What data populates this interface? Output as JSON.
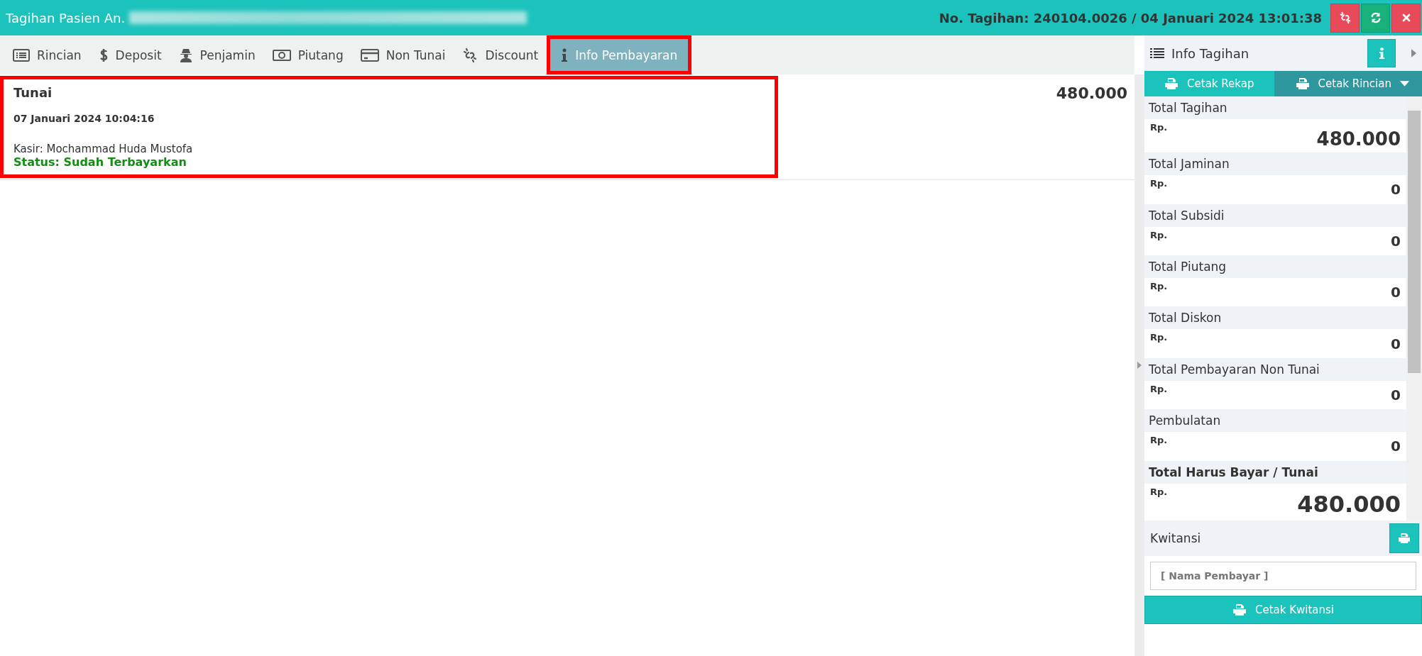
{
  "header": {
    "title": "Tagihan Pasien An.",
    "invoice": "No. Tagihan: 240104.0026 / 04 Januari 2024 13:01:38",
    "actions": [
      {
        "kind": "unlink"
      },
      {
        "kind": "refresh"
      },
      {
        "kind": "close"
      }
    ]
  },
  "tabs": [
    {
      "label": "Rincian",
      "kind": "list",
      "selected": false,
      "highlighted": false
    },
    {
      "label": "Deposit",
      "kind": "dollar",
      "selected": false,
      "highlighted": false
    },
    {
      "label": "Penjamin",
      "kind": "agent",
      "selected": false,
      "highlighted": false
    },
    {
      "label": "Piutang",
      "kind": "money",
      "selected": false,
      "highlighted": false
    },
    {
      "label": "Non Tunai",
      "kind": "card",
      "selected": false,
      "highlighted": false
    },
    {
      "label": "Discount",
      "kind": "unlink",
      "selected": false,
      "highlighted": false
    },
    {
      "label": "Info Pembayaran",
      "kind": "info",
      "selected": true,
      "highlighted": true
    }
  ],
  "payments": [
    {
      "method": "Tunai",
      "date": "07 Januari 2024 10:04:16",
      "cashier": "Kasir: Mochammad Huda Mustofa",
      "status": "Status: Sudah Terbayarkan",
      "amount": "480.000",
      "highlighted": true
    }
  ],
  "side_panel": {
    "title": "Info Tagihan",
    "print_buttons": [
      {
        "label": "Cetak Rekap",
        "dropdown": false
      },
      {
        "label": "Cetak Rincian",
        "dropdown": true
      }
    ],
    "totals": [
      {
        "label": "Total Tagihan",
        "currency": "Rp.",
        "value": "480.000",
        "kind": "headline"
      },
      {
        "label": "Total Jaminan",
        "currency": "Rp.",
        "value": "0",
        "kind": "line"
      },
      {
        "label": "Total Subsidi",
        "currency": "Rp.",
        "value": "0",
        "kind": "line"
      },
      {
        "label": "Total Piutang",
        "currency": "Rp.",
        "value": "0",
        "kind": "line"
      },
      {
        "label": "Total Diskon",
        "currency": "Rp.",
        "value": "0",
        "kind": "line"
      },
      {
        "label": "Total Pembayaran Non Tunai",
        "currency": "Rp.",
        "value": "0",
        "kind": "line"
      },
      {
        "label": "Pembulatan",
        "currency": "Rp.",
        "value": "0",
        "kind": "line"
      },
      {
        "label": "Total Harus Bayar / Tunai",
        "currency": "Rp.",
        "value": "480.000",
        "kind": "grand"
      }
    ],
    "receipt": {
      "title": "Kwitansi",
      "placeholder": "[ Nama Pembayar ]",
      "button": "Cetak Kwitansi"
    }
  }
}
